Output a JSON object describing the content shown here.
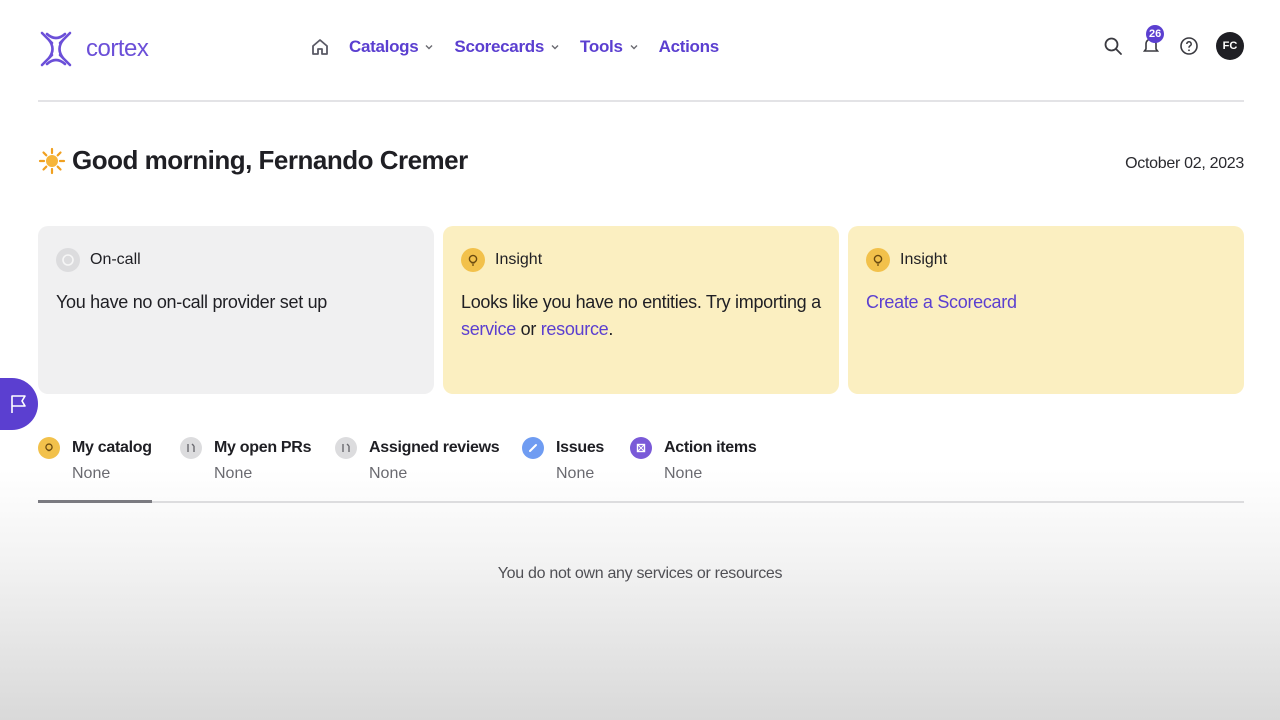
{
  "app": {
    "logo_text": "cortex"
  },
  "nav": {
    "items": [
      {
        "label": "Catalogs",
        "has_dropdown": true
      },
      {
        "label": "Scorecards",
        "has_dropdown": true
      },
      {
        "label": "Tools",
        "has_dropdown": true
      },
      {
        "label": "Actions",
        "has_dropdown": false
      }
    ]
  },
  "header": {
    "notification_count": "26",
    "avatar_initials": "FC"
  },
  "greeting": {
    "emoji": "sun-icon",
    "text": "Good morning, Fernando Cremer",
    "date": "October 02, 2023"
  },
  "cards": [
    {
      "type": "On-call",
      "body": "You have no on-call provider set up"
    },
    {
      "type": "Insight",
      "body_prefix": "Looks like you have no entities. Try importing a ",
      "link1": "service",
      "middle": " or ",
      "link2": "resource",
      "suffix": "."
    },
    {
      "type": "Insight",
      "link": "Create a Scorecard"
    }
  ],
  "tabs": [
    {
      "label": "My catalog",
      "value": "None",
      "icon": "bulb-icon"
    },
    {
      "label": "My open PRs",
      "value": "None",
      "icon": "pull-request-icon"
    },
    {
      "label": "Assigned reviews",
      "value": "None",
      "icon": "pull-request-icon"
    },
    {
      "label": "Issues",
      "value": "None",
      "icon": "issue-icon"
    },
    {
      "label": "Action items",
      "value": "None",
      "icon": "action-icon"
    }
  ],
  "empty_message": "You do not own any services or resources",
  "colors": {
    "accent": "#5b3fd0",
    "insight_bg": "#fbefc1",
    "oncall_bg": "#f0f0f1"
  }
}
